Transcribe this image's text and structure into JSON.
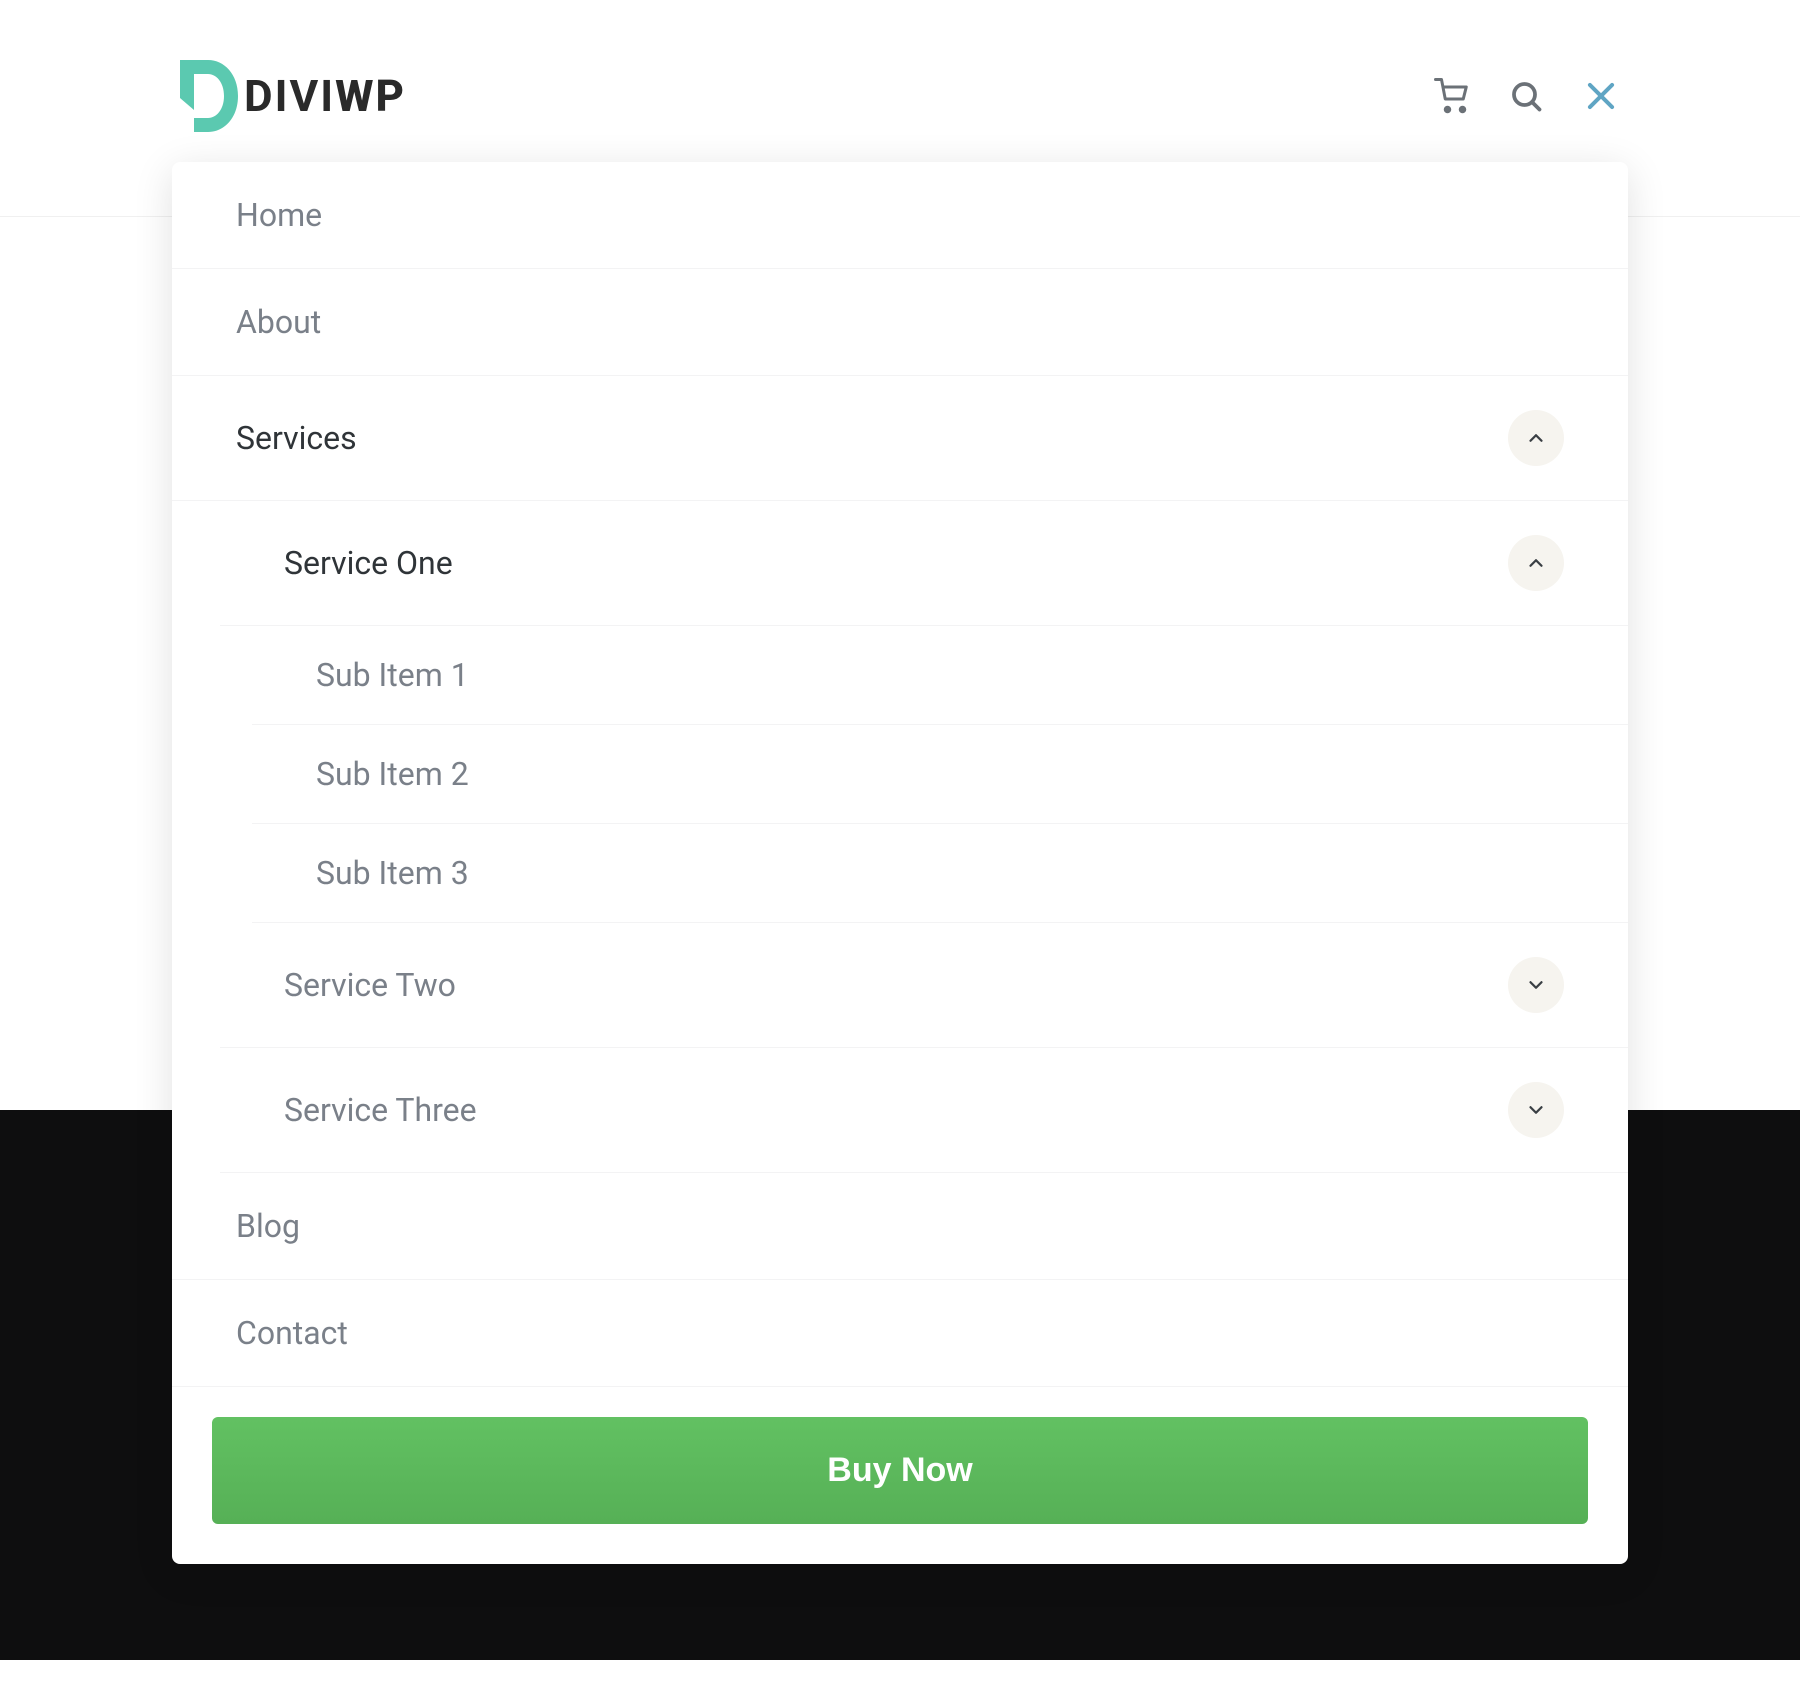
{
  "logo": {
    "text_divi": "DIVI",
    "text_wp": "WP"
  },
  "menu": {
    "items": [
      {
        "label": "Home",
        "expandable": false
      },
      {
        "label": "About",
        "expandable": false
      },
      {
        "label": "Services",
        "expandable": true,
        "expanded": true,
        "children": [
          {
            "label": "Service One",
            "expandable": true,
            "expanded": true,
            "children": [
              {
                "label": "Sub Item 1"
              },
              {
                "label": "Sub Item 2"
              },
              {
                "label": "Sub Item 3"
              }
            ]
          },
          {
            "label": "Service Two",
            "expandable": true,
            "expanded": false
          },
          {
            "label": "Service Three",
            "expandable": true,
            "expanded": false
          }
        ]
      },
      {
        "label": "Blog",
        "expandable": false
      },
      {
        "label": "Contact",
        "expandable": false
      }
    ]
  },
  "cta": {
    "buy_now": "Buy Now"
  }
}
